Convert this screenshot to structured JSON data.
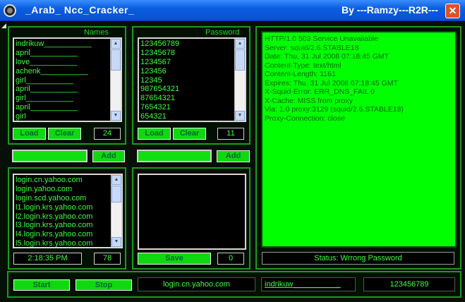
{
  "window": {
    "title": "_Arab_ Ncc_Cracker_",
    "author": "By  ---Ramzy---R2R---",
    "close_glyph": "✕"
  },
  "names_panel": {
    "label": "Names",
    "items": [
      "indrikuw___________",
      "april___________",
      "love___________",
      "achenk___________",
      "girl___________",
      "april___________",
      "girl___________",
      "april___________",
      "girl"
    ],
    "load_label": "Load",
    "clear_label": "Clear",
    "count": "24",
    "add_input_value": "",
    "add_label": "Add"
  },
  "password_panel": {
    "label": "Password",
    "items": [
      "123456789",
      "12345678",
      "1234567",
      "123456",
      "12345",
      "987654321",
      "87654321",
      "7654321",
      "654321"
    ],
    "load_label": "Load",
    "clear_label": "Clear",
    "count": "11",
    "add_input_value": "",
    "add_label": "Add"
  },
  "servers_panel": {
    "items": [
      "login.cn.yahoo.com",
      "login.yahoo.com",
      "login.scd.yahoo.com",
      "l1.login.krs.yahoo.com",
      "l2.login.krs.yahoo.com",
      "l3.login.krs.yahoo.com",
      "l4.login.krs.yahoo.com",
      "l5.login.krs.yahoo.com"
    ],
    "time": "2:18:35 PM",
    "count": "78"
  },
  "save_panel": {
    "save_label": "Save",
    "count": "0"
  },
  "response": {
    "lines": [
      "HTTP/1.0 503 Service Unavailable",
      "Server: squid/2.6.STABLE18",
      "Date: Thu, 31 Jul 2008 07:18:45 GMT",
      "Content-Type: text/html",
      "Content-Length: 1161",
      "Expires: Thu, 31 Jul 2008 07:18:45 GMT",
      "X-Squid-Error: ERR_DNS_FAIL 0",
      "X-Cache: MISS from proxy",
      "Via: 1.0 proxy:3129 (squid/2.6.STABLE18)",
      "Proxy-Connection: close"
    ],
    "status": "Status:   Wrrong Password"
  },
  "bottom": {
    "start_label": "Start",
    "stop_label": "Stop",
    "current_server": "login.cn.yahoo.com",
    "current_name": "indrikuw___________",
    "current_password": "123456789"
  },
  "colors": {
    "accent": "#00ff00",
    "title_bar": "#0a5fe0"
  }
}
